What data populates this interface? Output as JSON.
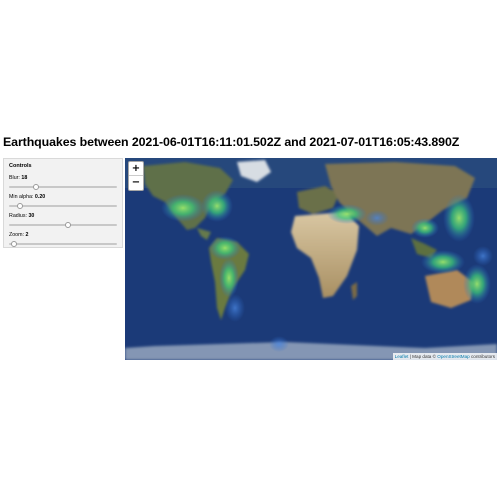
{
  "title": "Earthquakes between 2021-06-01T16:11:01.502Z and 2021-07-01T16:05:43.890Z",
  "controls": {
    "heading": "Controls",
    "blur": {
      "label": "Blur: ",
      "value": "18",
      "fraction": 0.25
    },
    "alpha": {
      "label": "Min alpha: ",
      "value": "0.20",
      "fraction": 0.1
    },
    "radius": {
      "label": "Radius: ",
      "value": "30",
      "fraction": 0.55
    },
    "zoom": {
      "label": "Zoom: ",
      "value": "2",
      "fraction": 0.05
    }
  },
  "map": {
    "zoom_in": "+",
    "zoom_out": "−",
    "attribution": {
      "leaflet": "Leaflet",
      "sep": " | Map data © ",
      "osm": "OpenStreetMap",
      "suffix": " contributors"
    }
  },
  "colors": {
    "ocean": "#1b3a78",
    "heat_low": "#2e6fd0",
    "heat_mid": "#3cc67a",
    "heat_high": "#8fe06a"
  }
}
